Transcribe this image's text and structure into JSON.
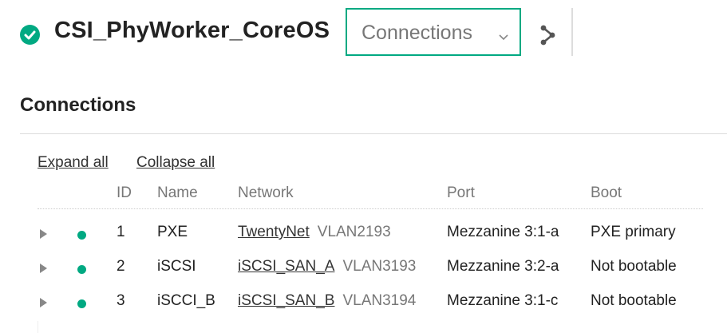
{
  "header": {
    "status": "ok",
    "title": "CSI_PhyWorker_CoreOS",
    "view_selector_value": "Connections",
    "share_icon": "share-icon"
  },
  "section": {
    "title": "Connections",
    "expand_all": "Expand all",
    "collapse_all": "Collapse all"
  },
  "table": {
    "columns": [
      "ID",
      "Name",
      "Network",
      "Port",
      "Boot"
    ],
    "rows": [
      {
        "id": "1",
        "name": "PXE",
        "network": "TwentyNet",
        "vlan": "VLAN2193",
        "port": "Mezzanine 3:1-a",
        "boot": "PXE primary"
      },
      {
        "id": "2",
        "name": "iSCSI",
        "network": "iSCSI_SAN_A",
        "vlan": "VLAN3193",
        "port": "Mezzanine 3:2-a",
        "boot": "Not bootable"
      },
      {
        "id": "3",
        "name": "iSCCI_B",
        "network": "iSCSI_SAN_B",
        "vlan": "VLAN3194",
        "port": "Mezzanine 3:1-c",
        "boot": "Not bootable"
      }
    ]
  },
  "colors": {
    "accent": "#01a982",
    "text": "#222222",
    "muted": "#777777"
  }
}
